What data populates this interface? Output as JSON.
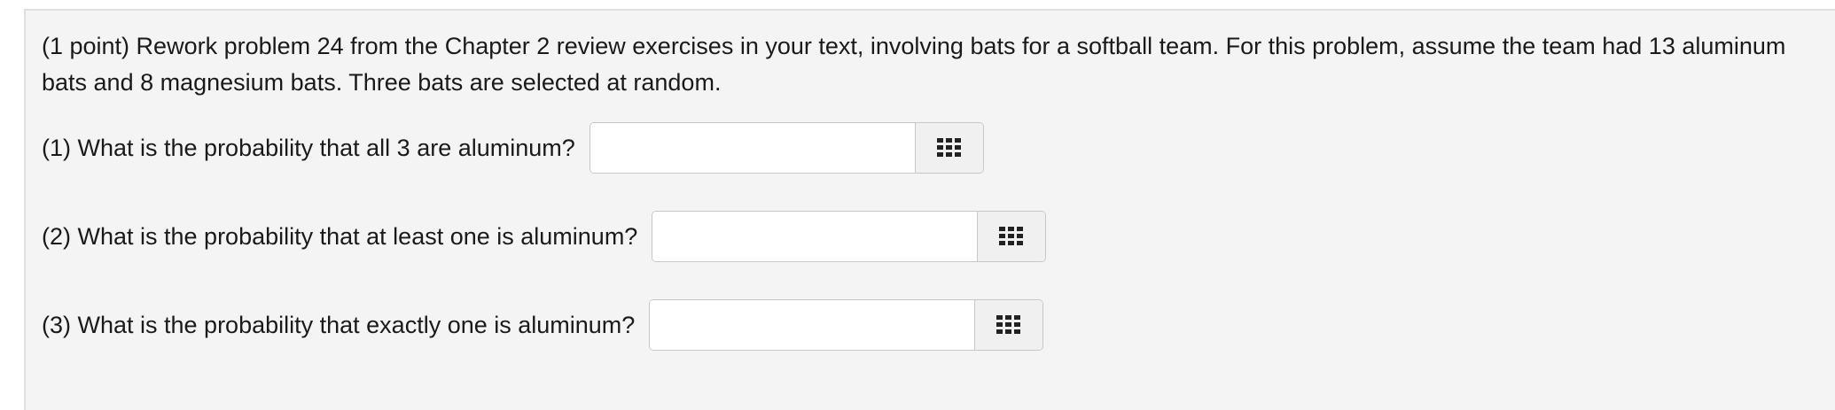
{
  "problem": {
    "statement": "(1 point) Rework problem 24 from the Chapter 2 review exercises in your text, involving bats for a softball team. For this problem, assume the team had 13 aluminum bats and 8 magnesium bats. Three bats are selected at random.",
    "questions": [
      {
        "label": "(1) What is the probability that all 3 are aluminum?",
        "answer": "",
        "palette_icon": "grid-icon"
      },
      {
        "label": "(2) What is the probability that at least one is aluminum?",
        "answer": "",
        "palette_icon": "grid-icon"
      },
      {
        "label": "(3) What is the probability that exactly one is aluminum?",
        "answer": "",
        "palette_icon": "grid-icon"
      }
    ]
  }
}
